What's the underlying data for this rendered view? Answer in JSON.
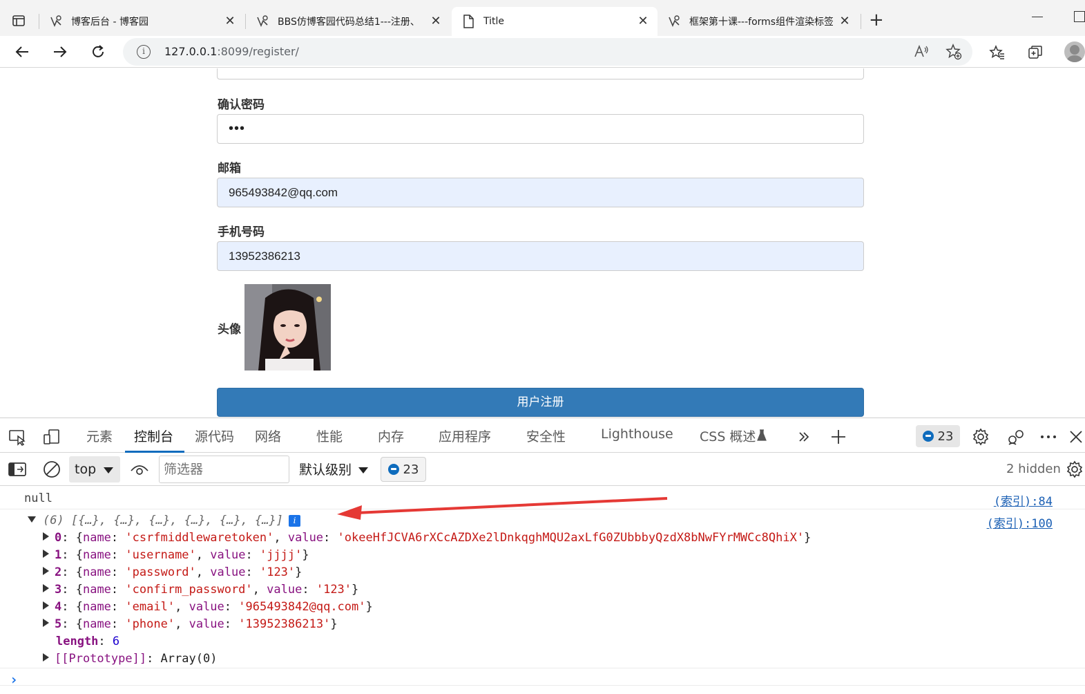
{
  "tabs": [
    {
      "title": "博客后台 - 博客园",
      "favicon": "cnblogs-icon"
    },
    {
      "title": "BBS仿博客园代码总结1---注册、",
      "favicon": "cnblogs-icon"
    },
    {
      "title": "Title",
      "favicon": "page-icon"
    },
    {
      "title": "框架第十课---forms组件渲染标签",
      "favicon": "cnblogs-icon"
    }
  ],
  "address_bar": {
    "host": "127.0.0.1",
    "rest": ":8099/register/"
  },
  "form": {
    "confirm_password_label": "确认密码",
    "confirm_password_value": "•••",
    "email_label": "邮箱",
    "email_value": "965493842@qq.com",
    "phone_label": "手机号码",
    "phone_value": "13952386213",
    "avatar_label": "头像",
    "submit_label": "用户注册"
  },
  "devtools": {
    "tabs": [
      "元素",
      "控制台",
      "源代码",
      "网络",
      "性能",
      "内存",
      "应用程序",
      "安全性",
      "Lighthouse",
      "CSS 概述"
    ],
    "active_tab": "控制台",
    "message_count": "23",
    "context": "top",
    "filter_placeholder": "筛选器",
    "level": "默认级别",
    "hidden": "2 hidden"
  },
  "console": {
    "null_line": "null",
    "null_source": "(索引):84",
    "array_summary": "(6) [{…}, {…}, {…}, {…}, {…}, {…}]",
    "array_source": "(索引):100",
    "items": [
      {
        "idx": "0",
        "name": "csrfmiddlewaretoken",
        "value": "okeeHfJCVA6rXCcAZDXe2lDnkqghMQU2axLfG0ZUbbbyQzdX8bNwFYrMWCc8QhiX"
      },
      {
        "idx": "1",
        "name": "username",
        "value": "jjjj"
      },
      {
        "idx": "2",
        "name": "password",
        "value": "123"
      },
      {
        "idx": "3",
        "name": "confirm_password",
        "value": "123"
      },
      {
        "idx": "4",
        "name": "email",
        "value": "965493842@qq.com"
      },
      {
        "idx": "5",
        "name": "phone",
        "value": "13952386213"
      }
    ],
    "length_key": "length",
    "length_value": "6",
    "prototype_key": "[[Prototype]]",
    "prototype_value": "Array(0)"
  },
  "colors": {
    "accent": "#0f6cbd",
    "submit": "#337ab7",
    "autofill": "#e8f0fe",
    "annotation_arrow": "#e53935"
  }
}
